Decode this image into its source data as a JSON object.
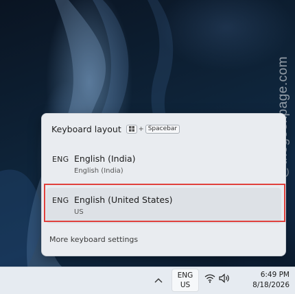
{
  "watermark": "@thegeekpage.com",
  "flyout": {
    "title": "Keyboard layout",
    "shortcut_plus": "+",
    "shortcut_key": "Spacebar",
    "layouts": [
      {
        "code": "ENG",
        "name": "English (India)",
        "sub": "English (India)"
      },
      {
        "code": "ENG",
        "name": "English (United States)",
        "sub": "US"
      }
    ],
    "more_settings": "More keyboard settings"
  },
  "taskbar": {
    "lang_line1": "ENG",
    "lang_line2": "US",
    "time": "6:49 PM",
    "date": "8/18/2026",
    "icons": [
      "chevron-up-icon",
      "wifi-icon",
      "speaker-icon"
    ]
  },
  "colors": {
    "highlight": "#e0403c",
    "flyout_bg": "#e9ecf0",
    "taskbar_bg": "#e6ebf1"
  }
}
